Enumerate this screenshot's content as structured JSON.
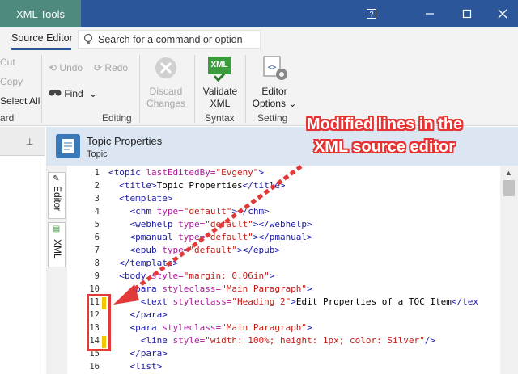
{
  "app": {
    "tab_title": "XML Tools"
  },
  "window_buttons": [
    "?",
    "—",
    "☐",
    "✕"
  ],
  "ribbon_tabs": {
    "active": "Source Editor"
  },
  "search": {
    "placeholder": "Search for a command or option"
  },
  "clipboard": {
    "cut": "Cut",
    "copy": "Copy",
    "select_all": "Select All",
    "group": "ard"
  },
  "editing": {
    "undo": "Undo",
    "redo": "Redo",
    "find": "Find",
    "group": "Editing",
    "discard_line1": "Discard",
    "discard_line2": "Changes"
  },
  "syntax": {
    "validate_line1": "Validate",
    "validate_line2": "XML",
    "group": "Syntax",
    "xml_badge": "XML"
  },
  "settings": {
    "options_line1": "Editor",
    "options_line2": "Options",
    "group": "Setting"
  },
  "document": {
    "title": "Topic Properties",
    "subtitle": "Topic"
  },
  "side_tabs": {
    "editor": "Editor",
    "xml": "XML"
  },
  "editor": {
    "line_numbers": [
      "1",
      "2",
      "3",
      "4",
      "5",
      "6",
      "7",
      "8",
      "9",
      "10",
      "11",
      "12",
      "13",
      "14",
      "15",
      "16"
    ],
    "modified_lines": [
      11,
      14
    ]
  },
  "annotation": {
    "line1": "Modified lines in the",
    "line2": "XML source editor"
  },
  "colors": {
    "titlebar": "#2b579a",
    "app_tab": "#4e8a7d",
    "modified_marker": "#f2c600",
    "annotation_red": "#e23a3a"
  }
}
